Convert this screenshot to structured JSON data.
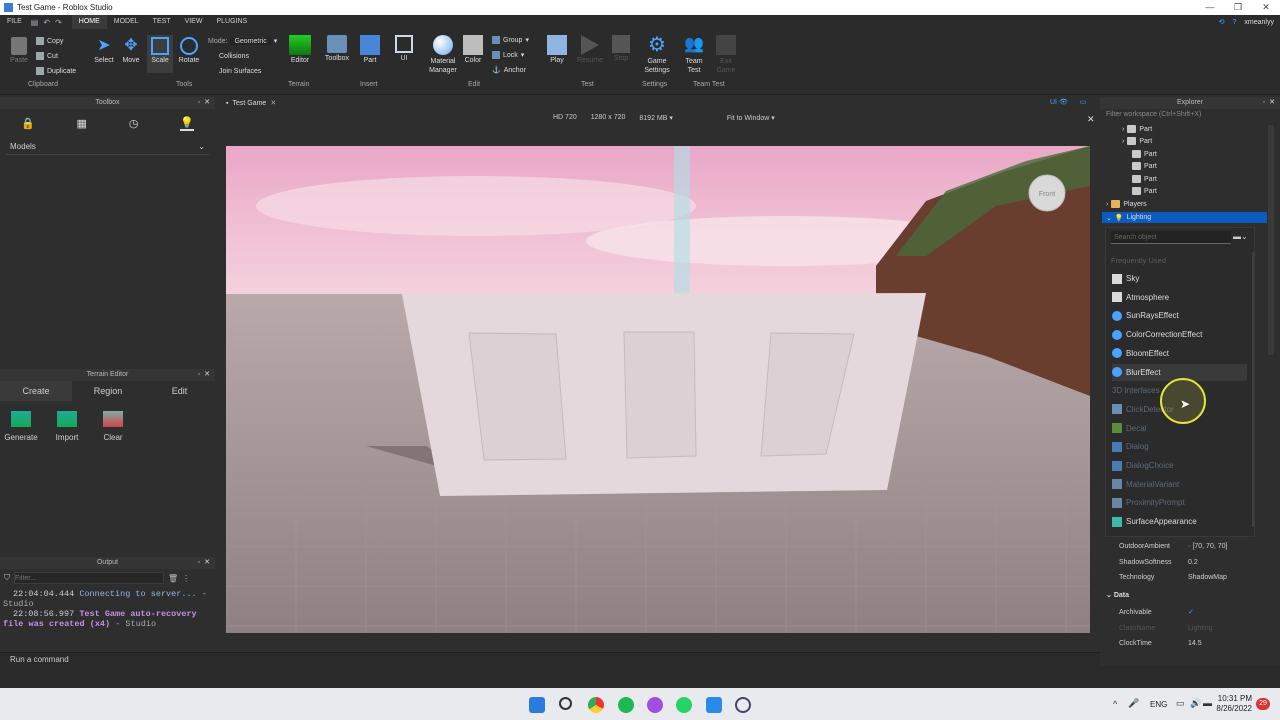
{
  "window": {
    "title": "Test Game - Roblox Studio",
    "user": "xmeanlyy"
  },
  "menu": {
    "items": [
      "FILE",
      "HOME",
      "MODEL",
      "TEST",
      "VIEW",
      "PLUGINS"
    ],
    "active": "HOME"
  },
  "ribbon": {
    "clipboard": {
      "paste": "Paste",
      "copy": "Copy",
      "cut": "Cut",
      "duplicate": "Duplicate",
      "group": "Clipboard"
    },
    "tools": {
      "select": "Select",
      "move": "Move",
      "scale": "Scale",
      "rotate": "Rotate",
      "group": "Tools"
    },
    "mode": {
      "label": "Mode:",
      "value": "Geometric",
      "collisions": "Collisions",
      "join": "Join Surfaces"
    },
    "terrain": {
      "editor": "Editor",
      "group": "Terrain"
    },
    "insert": {
      "toolbox": "Toolbox",
      "part": "Part",
      "ui": "UI",
      "group": "Insert"
    },
    "edit": {
      "material": "Material Manager",
      "color": "Color",
      "group_btn": "Group",
      "lock": "Lock",
      "anchor": "Anchor",
      "group": "Edit"
    },
    "test": {
      "play": "Play",
      "resume": "Resume",
      "stop": "Stop",
      "group": "Test"
    },
    "settings": {
      "game": "Game Settings",
      "group": "Settings"
    },
    "teamtest": {
      "team": "Team Test",
      "exit": "Exit Game",
      "group": "Team Test"
    }
  },
  "toolbox": {
    "title": "Toolbox",
    "category": "Models"
  },
  "terrain": {
    "title": "Terrain Editor",
    "tabs": [
      "Create",
      "Region",
      "Edit"
    ],
    "tools": [
      "Generate",
      "Import",
      "Clear"
    ]
  },
  "output": {
    "title": "Output",
    "filter_placeholder": "Filter...",
    "lines": [
      {
        "time": "22:04:04.444",
        "text": "Connecting to server...",
        "source": "- Studio"
      },
      {
        "time": "22:08:56.997",
        "text": "Test Game auto-recovery file was created (x4)",
        "source": "- Studio"
      }
    ]
  },
  "command_bar": {
    "placeholder": "Run a command"
  },
  "doc_tab": {
    "label": "Test Game"
  },
  "viewport_bar": {
    "device": "HD 720",
    "resolution": "1280 x 720",
    "memory": "8192 MB",
    "fit": "Fit to Window",
    "ui_toggle": "UI"
  },
  "viewcube": {
    "face": "Front"
  },
  "explorer": {
    "title": "Explorer",
    "filter_placeholder": "Filter workspace (Ctrl+Shift+X)",
    "parts": [
      "Part",
      "Part",
      "Part",
      "Part",
      "Part",
      "Part"
    ],
    "players": "Players",
    "lighting": "Lighting"
  },
  "insert_menu": {
    "search_placeholder": "Search object",
    "frequently_used": "Frequently Used",
    "items": [
      {
        "label": "Sky",
        "color": "#d9d9d9",
        "dim": false
      },
      {
        "label": "Atmosphere",
        "color": "#d9d9d9",
        "dim": false
      },
      {
        "label": "SunRaysEffect",
        "color": "#4aa3ff",
        "dim": false
      },
      {
        "label": "ColorCorrectionEffect",
        "color": "#4aa3ff",
        "dim": false
      },
      {
        "label": "BloomEffect",
        "color": "#4aa3ff",
        "dim": false
      },
      {
        "label": "BlurEffect",
        "color": "#4aa3ff",
        "dim": false
      },
      {
        "label": "3D Interfaces",
        "color": "#2e2e2e",
        "dim": true
      },
      {
        "label": "ClickDetector",
        "color": "#6a8fb0",
        "dim": true
      },
      {
        "label": "Decal",
        "color": "#5e8a3e",
        "dim": true
      },
      {
        "label": "Dialog",
        "color": "#4b7bb5",
        "dim": true
      },
      {
        "label": "DialogChoice",
        "color": "#4b7bb5",
        "dim": true
      },
      {
        "label": "MaterialVariant",
        "color": "#6b86a3",
        "dim": true
      },
      {
        "label": "ProximityPrompt",
        "color": "#6b86a3",
        "dim": true
      },
      {
        "label": "SurfaceAppearance",
        "color": "#3fb8a8",
        "dim": false
      }
    ]
  },
  "properties": {
    "rows": [
      {
        "name": "OutdoorAmbient",
        "value": "[70, 70, 70]"
      },
      {
        "name": "ShadowSoftness",
        "value": "0.2"
      },
      {
        "name": "Technology",
        "value": "ShadowMap"
      }
    ],
    "section": "Data",
    "data_rows": [
      {
        "name": "Archivable",
        "value": "✓"
      },
      {
        "name": "ClassName",
        "value": "Lighting"
      },
      {
        "name": "ClockTime",
        "value": "14.5"
      }
    ]
  },
  "taskbar": {
    "lang": "ENG",
    "time": "10:31 PM",
    "date": "8/26/2022",
    "badge": "29"
  }
}
